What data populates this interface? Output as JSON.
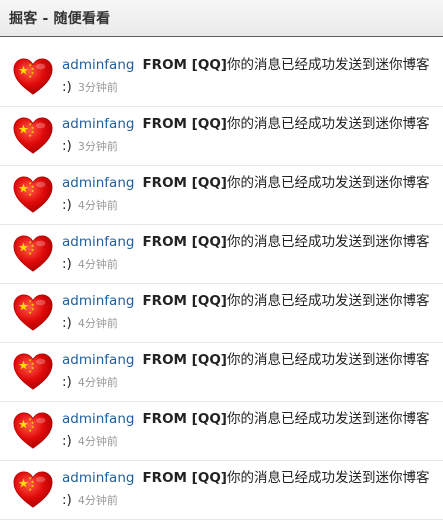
{
  "header": {
    "title": "掘客 - 随便看看"
  },
  "feed": {
    "items": [
      {
        "user": "adminfang",
        "source": "FROM [QQ]",
        "message": "你的消息已经成功发送到迷你博客 :)",
        "time": "3分钟前",
        "avatar_icon": "china-flag-heart-icon"
      },
      {
        "user": "adminfang",
        "source": "FROM [QQ]",
        "message": "你的消息已经成功发送到迷你博客 :)",
        "time": "3分钟前",
        "avatar_icon": "china-flag-heart-icon"
      },
      {
        "user": "adminfang",
        "source": "FROM [QQ]",
        "message": "你的消息已经成功发送到迷你博客 :)",
        "time": "4分钟前",
        "avatar_icon": "china-flag-heart-icon"
      },
      {
        "user": "adminfang",
        "source": "FROM [QQ]",
        "message": "你的消息已经成功发送到迷你博客 :)",
        "time": "4分钟前",
        "avatar_icon": "china-flag-heart-icon"
      },
      {
        "user": "adminfang",
        "source": "FROM [QQ]",
        "message": "你的消息已经成功发送到迷你博客 :)",
        "time": "4分钟前",
        "avatar_icon": "china-flag-heart-icon"
      },
      {
        "user": "adminfang",
        "source": "FROM [QQ]",
        "message": "你的消息已经成功发送到迷你博客 :)",
        "time": "4分钟前",
        "avatar_icon": "china-flag-heart-icon"
      },
      {
        "user": "adminfang",
        "source": "FROM [QQ]",
        "message": "你的消息已经成功发送到迷你博客 :)",
        "time": "4分钟前",
        "avatar_icon": "china-flag-heart-icon"
      },
      {
        "user": "adminfang",
        "source": "FROM [QQ]",
        "message": "你的消息已经成功发送到迷你博客 :)",
        "time": "4分钟前",
        "avatar_icon": "china-flag-heart-icon"
      }
    ]
  },
  "colors": {
    "link": "#1f5f9e",
    "heart_red": "#e00a0a",
    "star_yellow": "#ffde00",
    "time_gray": "#999999"
  }
}
